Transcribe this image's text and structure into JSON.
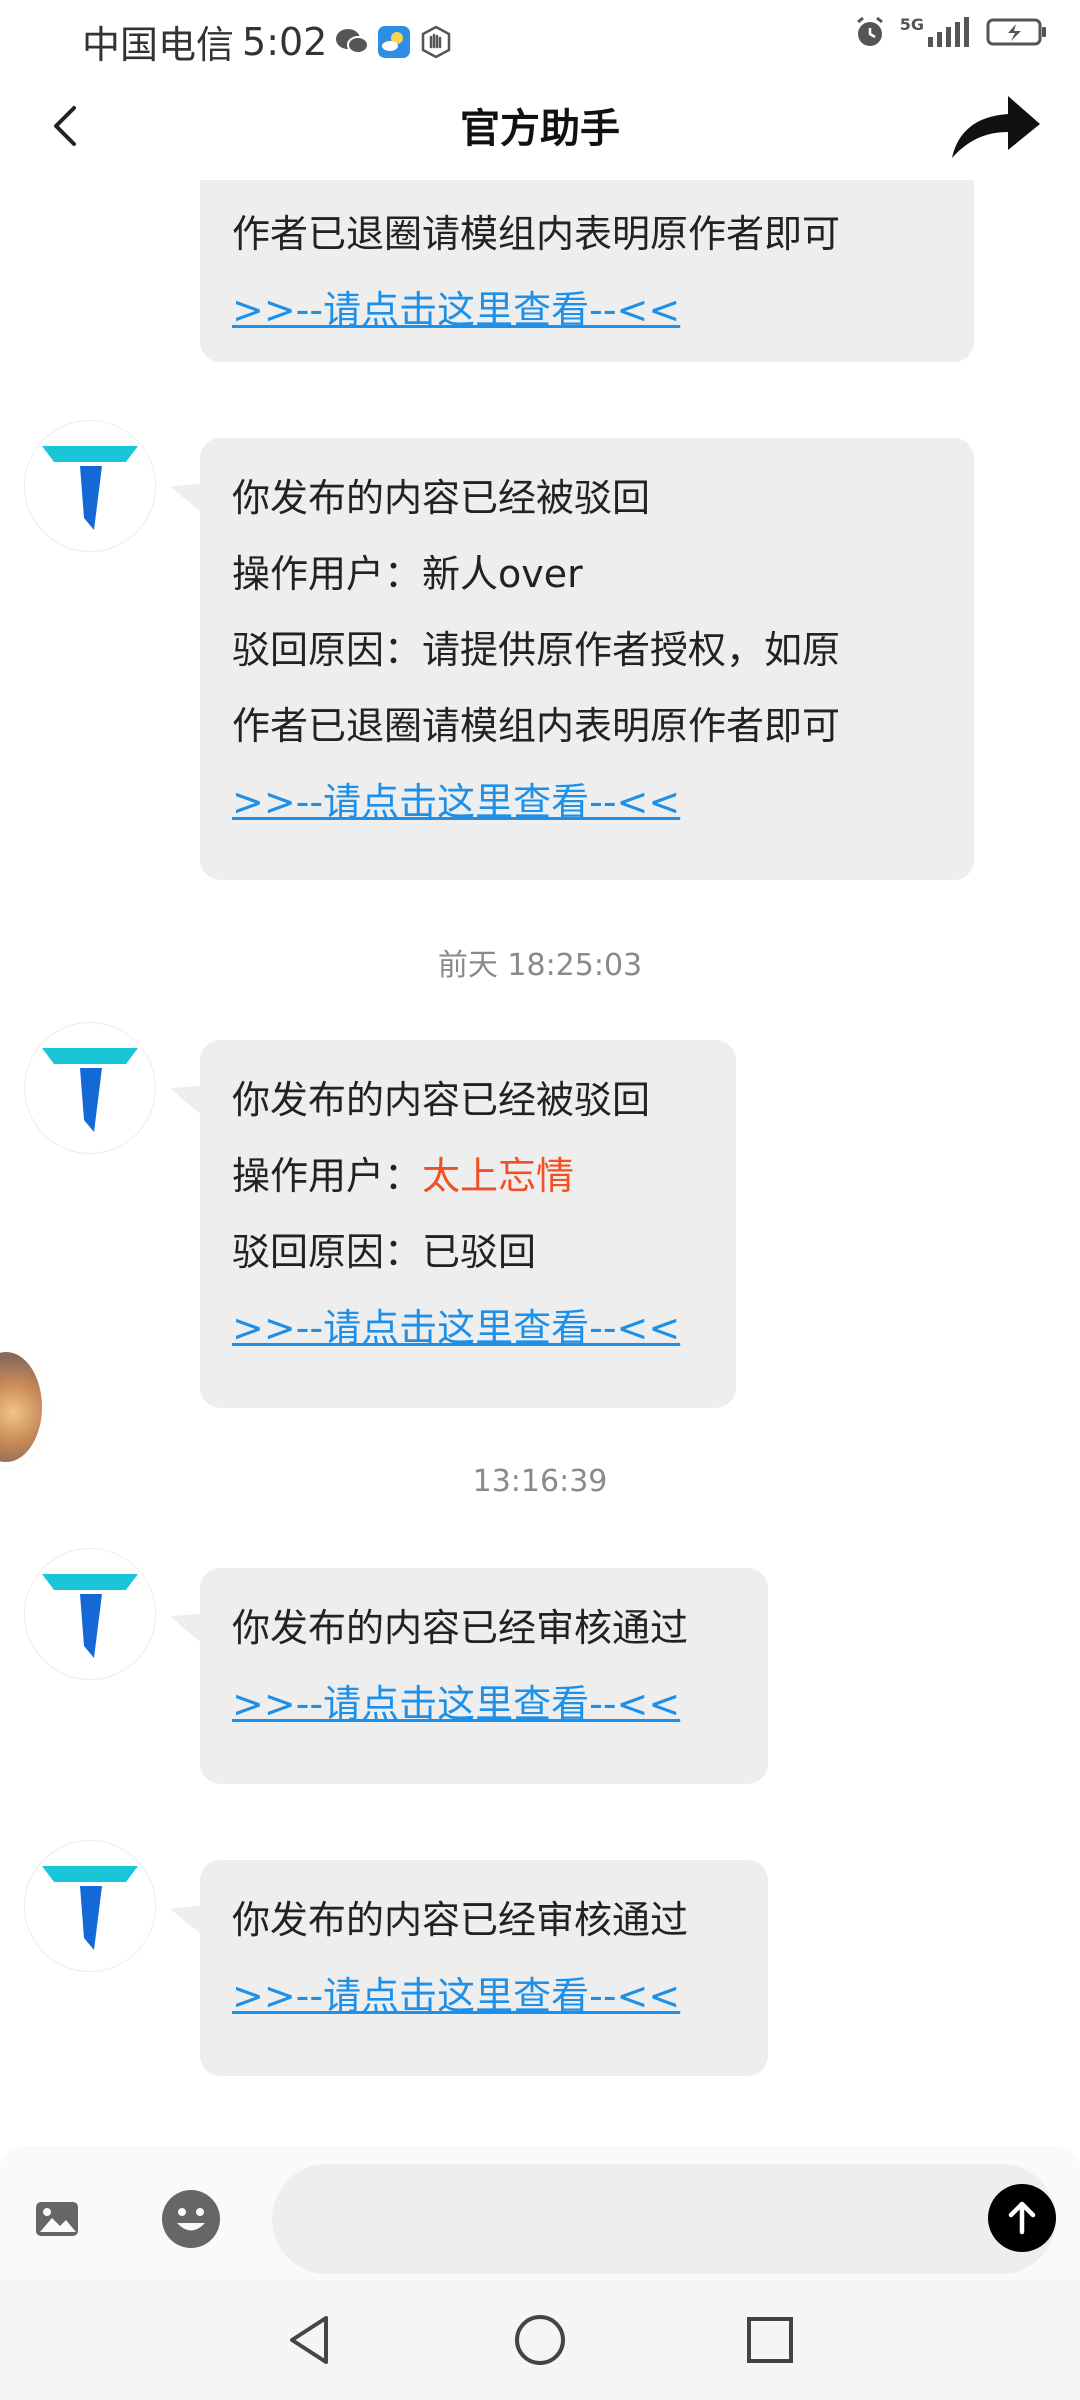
{
  "status_bar": {
    "carrier": "中国电信",
    "time": "5:02",
    "network": "5G",
    "left_icons": [
      "wechat-icon",
      "weather-icon",
      "hand-icon"
    ],
    "right_icons": [
      "alarm-icon",
      "signal-icon",
      "battery-icon"
    ]
  },
  "header": {
    "title": "官方助手",
    "back_icon": "chevron-left-icon",
    "share_icon": "share-arrow-icon"
  },
  "colors": {
    "link": "#1e90e8",
    "highlight": "#f05022",
    "bubble": "#eeeeee",
    "avatar_logo_top": "#19c6d8",
    "avatar_logo_stem": "#1569d6"
  },
  "messages": [
    {
      "lines": [
        "作者已退圈请模组内表明原作者即可"
      ],
      "link": ">>--请点击这里查看--<<"
    },
    {
      "lines": [
        "你发布的内容已经被驳回",
        "操作用户：新人over",
        "驳回原因：请提供原作者授权，如原",
        "作者已退圈请模组内表明原作者即可"
      ],
      "link": ">>--请点击这里查看--<<"
    },
    {
      "timestamp": "前天 18:25:03",
      "lines": [
        "你发布的内容已经被驳回"
      ],
      "operator_label": "操作用户：",
      "operator_name": "太上忘情",
      "reason": "驳回原因：已驳回",
      "link": ">>--请点击这里查看--<<"
    },
    {
      "timestamp": "13:16:39",
      "lines": [
        "你发布的内容已经审核通过"
      ],
      "link": ">>--请点击这里查看--<<"
    },
    {
      "lines": [
        "你发布的内容已经审核通过"
      ],
      "link": ">>--请点击这里查看--<<"
    }
  ],
  "input_bar": {
    "placeholder": "",
    "image_icon": "image-icon",
    "emoji_icon": "emoji-icon",
    "send_icon": "send-arrow-icon"
  },
  "nav_bar": {
    "icons": [
      "nav-back-icon",
      "nav-home-icon",
      "nav-recents-icon"
    ]
  }
}
